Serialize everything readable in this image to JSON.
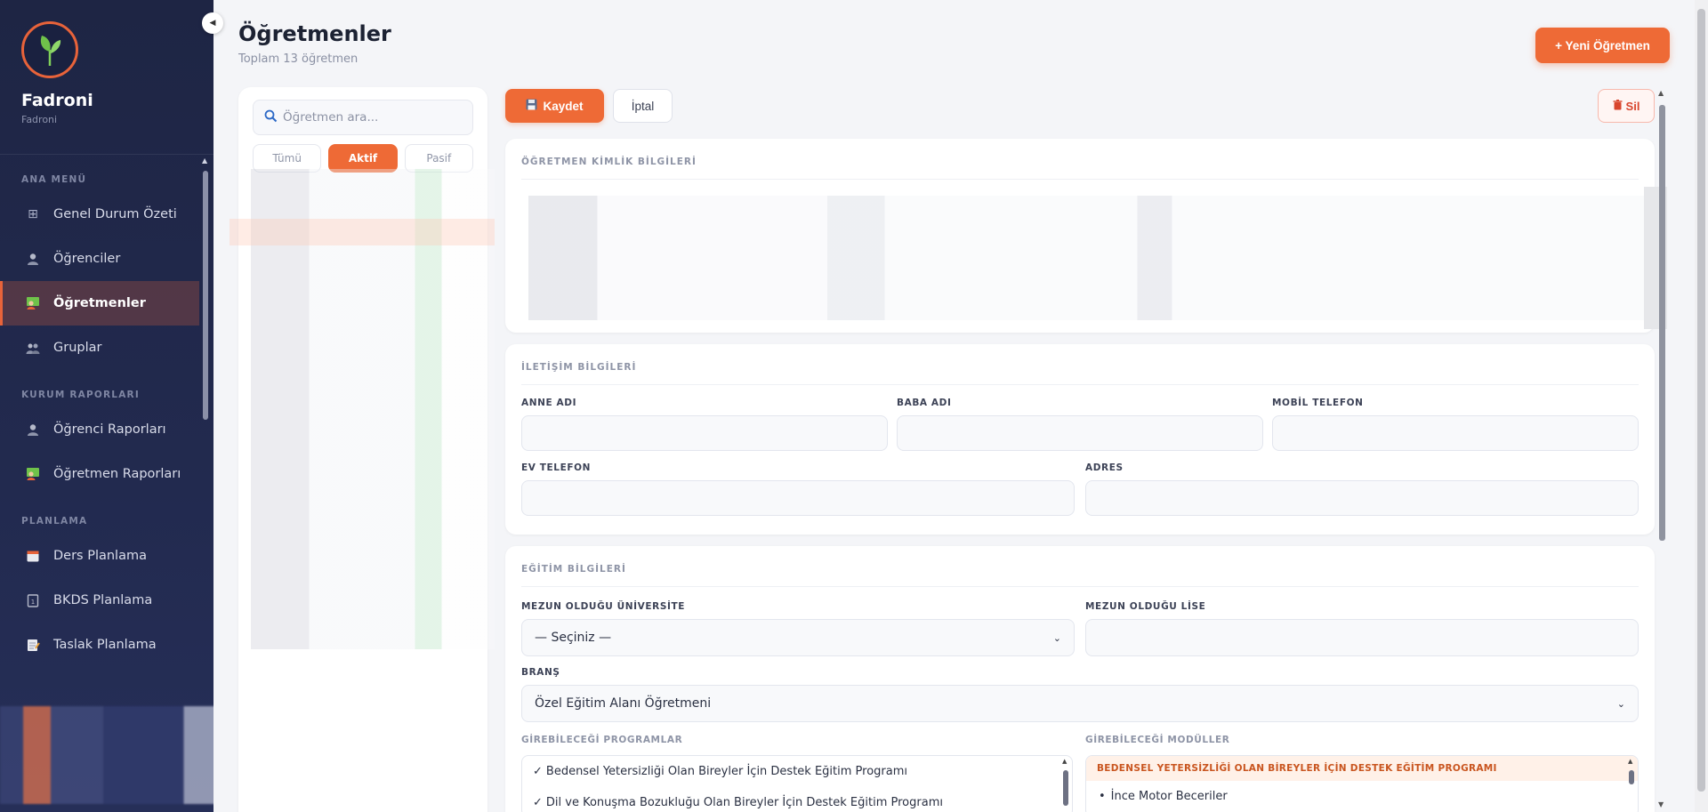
{
  "brand": {
    "name": "Fadroni",
    "sub": "Fadroni"
  },
  "nav": {
    "sections": {
      "main": "ANA MENÜ",
      "reports": "KURUM RAPORLARI",
      "planning": "PLANLAMA"
    },
    "items": {
      "dashboard": "Genel Durum Özeti",
      "students": "Öğrenciler",
      "teachers": "Öğretmenler",
      "groups": "Gruplar",
      "student_reports": "Öğrenci Raporları",
      "teacher_reports": "Öğretmen Raporları",
      "lesson_planning": "Ders Planlama",
      "bkds_planning": "BKDS Planlama",
      "draft_planning": "Taslak Planlama"
    }
  },
  "header": {
    "title": "Öğretmenler",
    "subtitle": "Toplam 13 öğretmen",
    "new_button": "+ Yeni Öğretmen"
  },
  "list": {
    "search_placeholder": "Öğretmen ara...",
    "filters": {
      "all": "Tümü",
      "active": "Aktif",
      "passive": "Pasif"
    },
    "selected_filter": "Aktif"
  },
  "toolbar": {
    "save": "Kaydet",
    "cancel": "İptal",
    "delete": "Sil"
  },
  "identity": {
    "title": "ÖĞRETMEN KİMLİK BİLGİLERİ"
  },
  "contact": {
    "title": "İLETİŞİM BİLGİLERİ",
    "mother_name": "ANNE ADI",
    "father_name": "BABA ADI",
    "mobile_phone": "MOBİL TELEFON",
    "home_phone": "EV TELEFON",
    "address": "ADRES"
  },
  "education": {
    "title": "EĞİTİM BİLGİLERİ",
    "university_label": "MEZUN OLDUĞU ÜNİVERSİTE",
    "university_value": "— Seçiniz —",
    "highschool_label": "MEZUN OLDUĞU LİSE",
    "branch_label": "BRANŞ",
    "branch_value": "Özel Eğitim Alanı Öğretmeni",
    "programs_label": "GİREBİLECEĞİ PROGRAMLAR",
    "programs": [
      "Bedensel Yetersizliği Olan Bireyler İçin Destek Eğitim Programı",
      "Dil ve Konuşma Bozukluğu Olan Bireyler İçin Destek Eğitim Programı"
    ],
    "modules_label": "GİREBİLECEĞİ MODÜLLER",
    "modules_group": "BEDENSEL YETERSİZLİĞİ OLAN BİREYLER İÇİN DESTEK EĞİTİM PROGRAMI",
    "modules": [
      "İnce Motor Beceriler"
    ]
  },
  "colors": {
    "accent": "#ee6a36",
    "sidebar": "#1e2544",
    "danger": "#d8452d"
  }
}
